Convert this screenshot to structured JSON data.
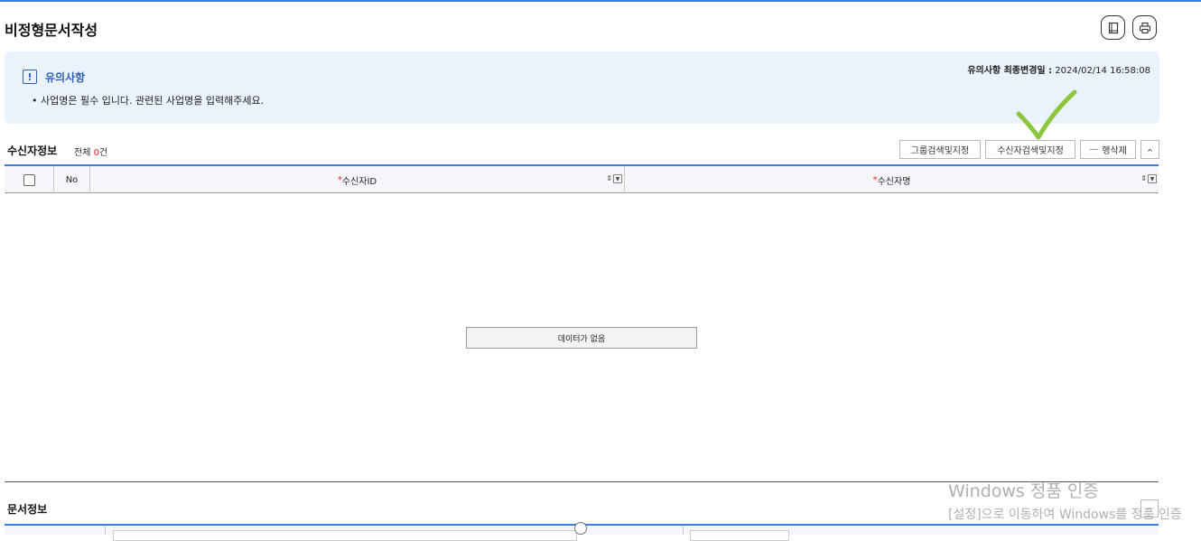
{
  "page": {
    "title": "비정형문서작성"
  },
  "header_icons": [
    {
      "icon": "book-icon"
    },
    {
      "icon": "print-icon"
    }
  ],
  "notice": {
    "icon": "exclamation-icon",
    "title": "유의사항",
    "date_label": "유의사항 최종변경일 :",
    "date_value": "2024/02/14 16:58:08",
    "message": "• 사업명은 필수 입니다. 관련된 사업명을 입력해주세요."
  },
  "recipients": {
    "title": "수신자정보",
    "total_label": "전체",
    "count": "0",
    "count_unit": "건",
    "buttons": {
      "group_search": "그룹검색및지정",
      "recipient_search": "수신자검색및지정",
      "delete_row": "행삭제",
      "delete_icon": "minus-icon",
      "collapse_icon": "chevron-up-icon"
    },
    "columns": {
      "no": "No",
      "required_mark": "*",
      "recipient_id": "수신자ID",
      "recipient_name": "수신자명"
    },
    "empty_message": "데이터가 없음"
  },
  "document": {
    "title": "문서정보",
    "toggle_icon": "chevron-up-icon"
  },
  "watermark": {
    "line1": "Windows 정품 인증",
    "line2": "[설정]으로 이동하여 Windows를 정품 인증"
  },
  "colors": {
    "accent": "#3b7ddd",
    "notice_bg": "#eaf2fc",
    "required": "#dd2222",
    "checkmark": "#8cc63f"
  }
}
